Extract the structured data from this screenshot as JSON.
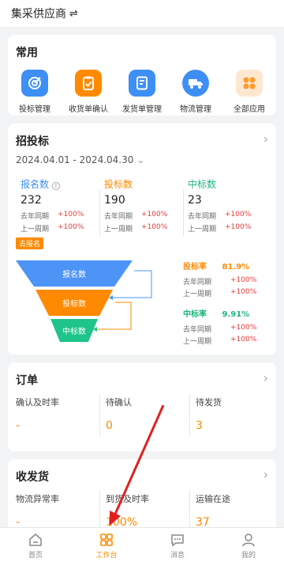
{
  "header": {
    "title": "集采供应商",
    "swap_icon": "⇌"
  },
  "common": {
    "title": "常用",
    "apps": [
      {
        "label": "投标管理",
        "icon": "target-icon",
        "color": "#3d8ff5"
      },
      {
        "label": "收货单确认",
        "icon": "clipboard-check-icon",
        "color": "#ff8a00"
      },
      {
        "label": "发货单管理",
        "icon": "document-edit-icon",
        "color": "#3d8ff5"
      },
      {
        "label": "物流管理",
        "icon": "truck-icon",
        "color": "#3d8ff5"
      },
      {
        "label": "全部应用",
        "icon": "grid-apps-icon",
        "color": "#ff9a2e"
      }
    ]
  },
  "bidding": {
    "title": "招投标",
    "date_range": "2024.04.01 - 2024.04.30",
    "stats": [
      {
        "name": "报名数",
        "value": "232",
        "color": "#3d8ff5",
        "yoy_label": "去年同期",
        "yoy": "+100%",
        "wow_label": "上一周期",
        "wow": "+100%"
      },
      {
        "name": "投标数",
        "value": "190",
        "color": "#ff8a00",
        "yoy_label": "去年同期",
        "yoy": "+100%",
        "wow_label": "上一周期",
        "wow": "+100%"
      },
      {
        "name": "中标数",
        "value": "23",
        "color": "#1fb57a",
        "yoy_label": "去年同期",
        "yoy": "+100%",
        "wow_label": "上一周期",
        "wow": "+100%"
      }
    ],
    "tag": "去报名",
    "funnel": [
      {
        "label": "报名数",
        "color": "#4d94f7"
      },
      {
        "label": "投标数",
        "color": "#ff8a00"
      },
      {
        "label": "中标数",
        "color": "#1fc48a"
      }
    ],
    "bid_rate": {
      "label": "投标率",
      "value": "81.9%",
      "color": "#ff8a00",
      "yoy_label": "去年同期",
      "yoy": "+100%",
      "wow_label": "上一周期",
      "wow": "+100%"
    },
    "win_rate": {
      "label": "中标率",
      "value": "9.91%",
      "color": "#1fb57a",
      "yoy_label": "去年同期",
      "yoy": "+100%",
      "wow_label": "上一周期",
      "wow": "+100%"
    }
  },
  "orders": {
    "title": "订单",
    "cols": [
      {
        "label": "确认及时率",
        "value": "-"
      },
      {
        "label": "待确认",
        "value": "0"
      },
      {
        "label": "待发货",
        "value": "3"
      }
    ]
  },
  "shipping": {
    "title": "收发货",
    "cols": [
      {
        "label": "物流异常率",
        "value": "-"
      },
      {
        "label": "到货及时率",
        "value": "100%"
      },
      {
        "label": "运输在途",
        "value": "37"
      }
    ]
  },
  "nav": [
    {
      "label": "首页",
      "icon": "home-icon"
    },
    {
      "label": "工作台",
      "icon": "workbench-grid-icon",
      "active": true
    },
    {
      "label": "消息",
      "icon": "message-icon"
    },
    {
      "label": "我的",
      "icon": "user-icon"
    }
  ],
  "colors": {
    "accent": "#ff8a00",
    "blue": "#3d8ff5",
    "green": "#1fb57a",
    "red": "#e63c3c",
    "annotation_arrow": "#e02020"
  }
}
